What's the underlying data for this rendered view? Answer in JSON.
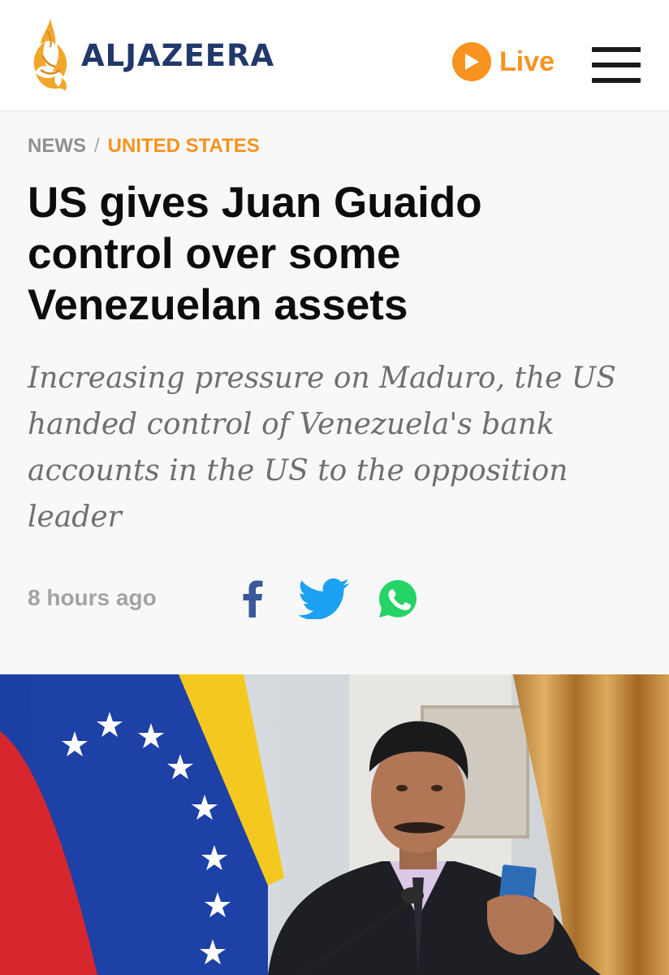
{
  "header": {
    "logo_text": "ALJAZEERA",
    "live_label": "Live",
    "menu_icon": "hamburger-menu-icon",
    "live_icon": "play-icon"
  },
  "breadcrumb": {
    "section": "NEWS",
    "separator": "/",
    "subsection": "UNITED STATES"
  },
  "article": {
    "headline": "US gives Juan Guaido control over some Venezuelan assets",
    "subheadline": "Increasing pressure on Maduro, the US handed control of Venezuela's bank accounts in the US to the opposition leader",
    "timestamp": "8 hours ago"
  },
  "share": {
    "facebook_icon": "facebook-icon",
    "twitter_icon": "twitter-icon",
    "whatsapp_icon": "whatsapp-icon"
  },
  "colors": {
    "brand_orange": "#f7931e",
    "brand_navy": "#20386b",
    "facebook_blue": "#3b5998",
    "twitter_blue": "#1da1f2",
    "whatsapp_green": "#25d366",
    "background": "#f8f8f8"
  }
}
